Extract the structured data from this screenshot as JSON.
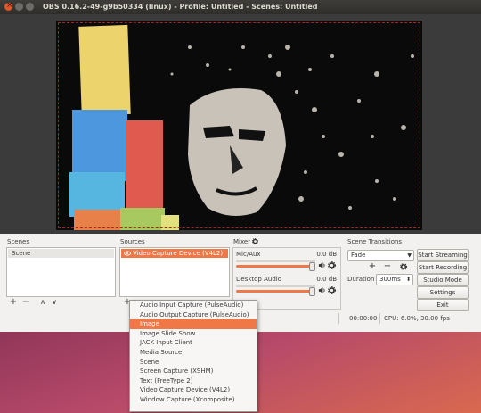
{
  "window": {
    "title": "OBS 0.16.2-49-g9b50334 (linux) - Profile: Untitled - Scenes: Untitled"
  },
  "scenes": {
    "label": "Scenes",
    "items": [
      "Scene"
    ],
    "add": "+",
    "remove": "−",
    "up": "∧",
    "down": "∨"
  },
  "sources": {
    "label": "Sources",
    "items": [
      "Video Capture Device (V4L2)"
    ],
    "add": "+"
  },
  "mixer": {
    "label": "Mixer",
    "channels": [
      {
        "name": "Mic/Aux",
        "db": "0.0 dB",
        "level": 1.0
      },
      {
        "name": "Desktop Audio",
        "db": "0.0 dB",
        "level": 1.0
      }
    ]
  },
  "transitions": {
    "label": "Scene Transitions",
    "selected": "Fade",
    "add": "+",
    "remove": "−",
    "duration_label": "Duration",
    "duration_value": "300ms"
  },
  "controls": {
    "start_streaming": "Start Streaming",
    "start_recording": "Start Recording",
    "studio_mode": "Studio Mode",
    "settings": "Settings",
    "exit": "Exit"
  },
  "status": {
    "time": "00:00:00",
    "cpu": "CPU: 6.0%, 30.00 fps"
  },
  "add_source_menu": {
    "items": [
      "Audio Input Capture (PulseAudio)",
      "Audio Output Capture (PulseAudio)",
      "Image",
      "Image Slide Show",
      "JACK Input Client",
      "Media Source",
      "Scene",
      "Screen Capture (XSHM)",
      "Text (FreeType 2)",
      "Video Capture Device (V4L2)",
      "Window Capture (Xcomposite)"
    ],
    "highlighted_index": 2
  },
  "colors": {
    "accent": "#f07746",
    "titlebar": "#3e3d39",
    "close_button": "#e0562a"
  }
}
